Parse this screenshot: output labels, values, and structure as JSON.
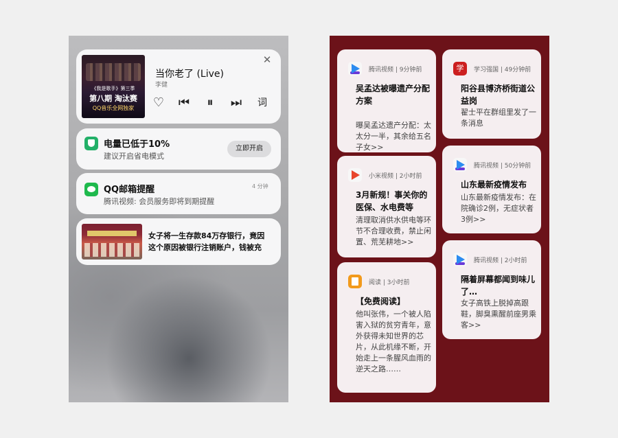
{
  "left": {
    "music": {
      "album_lines": [
        "《我是歌手》第三季",
        "第八期 淘汰赛",
        "QQ音乐全网独家"
      ],
      "title": "当你老了 (Live)",
      "artist": "李健",
      "close_icon": "✕",
      "controls": {
        "like": "♡",
        "prev": "⏮",
        "pause": "⏸",
        "next": "⏭",
        "lyrics": "词"
      }
    },
    "battery": {
      "icon": "shield-icon",
      "title": "电量已低于10%",
      "body": "建议开启省电模式",
      "button": "立即开启"
    },
    "wechat": {
      "icon": "wechat-icon",
      "title": "QQ邮箱提醒",
      "body": "腾讯视频: 会员服务即将到期提醒",
      "time": "4 分钟"
    },
    "news": {
      "line1": "女子将一生存款84万存银行，竟因",
      "line2": "这个原因被银行注销账户，钱被充"
    }
  },
  "right": {
    "cards": [
      {
        "app": "腾讯视频",
        "time": "9分钟前",
        "title": "吴孟达被曝遗产分配方案",
        "body": "曝吴孟达遗产分配：太太分一半，其余给五名子女>>"
      },
      {
        "app": "学习强国",
        "time": "49分钟前",
        "title": "阳谷县博济桥街道公益岗",
        "body": "翟士平在群组里发了一条消息"
      },
      {
        "app": "小米视频",
        "time": "2小时前",
        "title": "3月新规！事关你的医保、水电费等",
        "body": "清理取消供水供电等环节不合理收费，禁止闲置、荒芜耕地>>"
      },
      {
        "app": "腾讯视频",
        "time": "50分钟前",
        "title": "山东最新疫情发布",
        "body": "山东最新疫情发布：在院确诊2例，无症状者3例>>"
      },
      {
        "app": "阅读",
        "time": "3小时前",
        "title": "【免费阅读】",
        "body": "他叫张伟，一个被人陷害入狱的贫穷青年，意外获得未知世界的芯片，从此机缘不断，开始走上一条腥风血雨的逆天之路……"
      },
      {
        "app": "腾讯视频",
        "time": "2小时前",
        "title": "隔着屏幕都闻到味儿了…",
        "body": "女子高铁上脱掉高跟鞋，脚臭熏醒前座男乘客>>"
      }
    ]
  }
}
